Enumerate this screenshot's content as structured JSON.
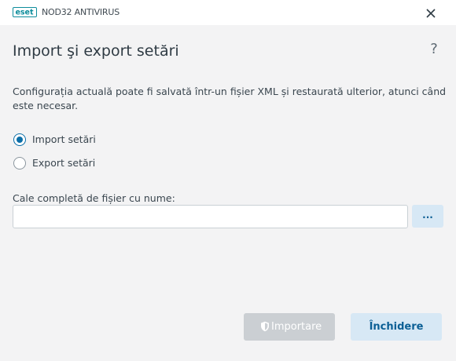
{
  "window": {
    "brand": "ESET",
    "product": "NOD32 ANTIVIRUS",
    "close_icon": "close-icon"
  },
  "header": {
    "title": "Import şi export setări",
    "help": "?"
  },
  "content": {
    "description": "Configurația actuală poate fi salvată într-un fișier XML și restaurată ulterior, atunci când este necesar.",
    "options": [
      {
        "label": "Import setări",
        "checked": true
      },
      {
        "label": "Export setări",
        "checked": false
      }
    ],
    "path_label": "Cale completă de fișier cu nume:",
    "path_value": "",
    "browse_label": "..."
  },
  "footer": {
    "import_label": "Importare",
    "import_enabled": false,
    "close_label": "Închidere"
  },
  "colors": {
    "accent": "#0b6ea8",
    "brand_teal": "#0e8d9c",
    "button_secondary_bg": "#d7e8f5",
    "disabled_bg": "#cbcfd3"
  }
}
